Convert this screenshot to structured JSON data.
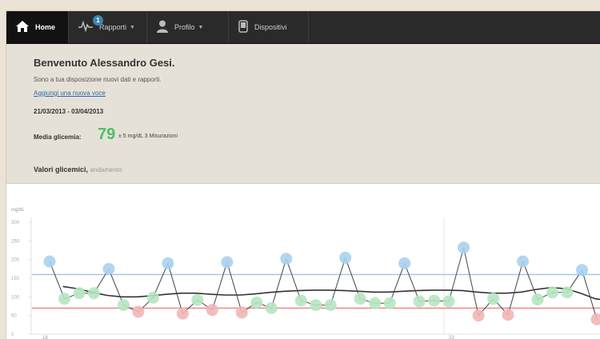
{
  "nav": {
    "home": "Home",
    "reports": "Rapporti",
    "reports_badge": "1",
    "profile": "Profilo",
    "devices": "Dispositivi"
  },
  "header": {
    "welcome": "Benvenuto Alessandro Gesi.",
    "subtitle": "Sono a tua disposizione nuovi dati e rapporti.",
    "add_entry": "Aggiungi una nuova voce",
    "date_range": "21/03/2013 - 03/04/2013",
    "avg_label": "Media glicemia:",
    "avg_value": "79",
    "avg_unit": "± 5 mg/dL 3 Misurazioni",
    "section_title": "Valori glicemici,",
    "section_sub": "andamento"
  },
  "colors": {
    "high": "#a9d1f0",
    "normal": "#b6e5c2",
    "low": "#f2b6b6",
    "upper_line": "#a5c8ea",
    "lower_line": "#ee8a8a",
    "trend": "#333333",
    "avg_value": "#4cbf6a"
  },
  "chart_data": {
    "type": "line",
    "ylabel": "mg/dL",
    "ylim": [
      0,
      300
    ],
    "yticks": [
      "300",
      "250",
      "200",
      "150",
      "100",
      "50",
      "0"
    ],
    "x_tick_labels": [
      "18",
      "23"
    ],
    "thresholds": {
      "upper": 160,
      "lower": 70
    },
    "series": [
      {
        "values": [
          195,
          95,
          110,
          110,
          175,
          78,
          60,
          98,
          190,
          55,
          92,
          65,
          193,
          58,
          85,
          70,
          202,
          90,
          78,
          78,
          205,
          95,
          83,
          83,
          190,
          88,
          90,
          88,
          232,
          50,
          95,
          52,
          195,
          93,
          112,
          112,
          172,
          40
        ]
      },
      {
        "values": [
          128,
          122,
          112,
          104,
          100,
          100,
          103,
          107,
          110,
          110,
          107,
          105,
          105,
          108,
          112,
          115,
          117,
          118,
          118,
          117,
          115,
          113,
          113,
          115,
          117,
          118,
          118,
          117,
          113,
          110,
          110,
          113,
          120,
          125,
          122,
          110,
          95,
          90
        ]
      }
    ]
  }
}
